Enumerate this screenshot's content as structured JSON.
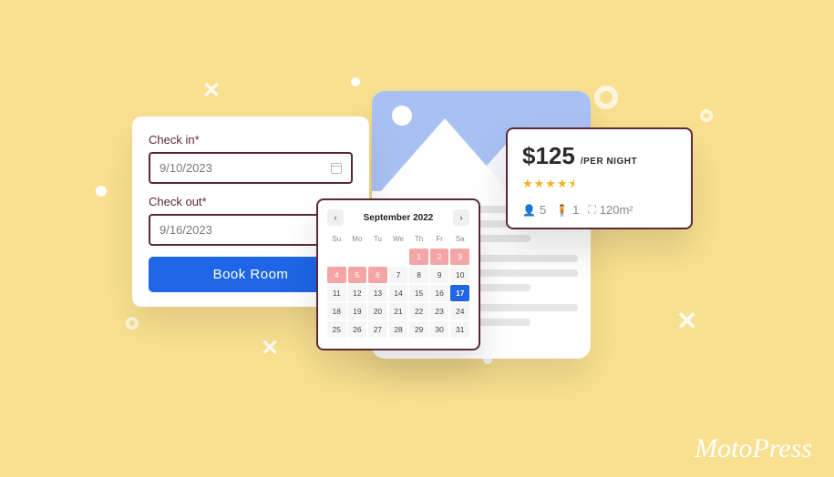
{
  "brand": "MotoPress",
  "booking": {
    "checkin_label": "Check in*",
    "checkin_value": "9/10/2023",
    "checkout_label": "Check out*",
    "checkout_value": "9/16/2023",
    "button": "Book Room"
  },
  "calendar": {
    "title": "September 2022",
    "dow": [
      "Su",
      "Mo",
      "Tu",
      "We",
      "Th",
      "Fr",
      "Sa"
    ],
    "blanks": 4,
    "days": 31,
    "past_end": 6,
    "selected": 17
  },
  "price": {
    "amount": "$125",
    "unit": "/PER NIGHT",
    "rating": 4.5,
    "guests": "5",
    "beds": "1",
    "area": "120m²"
  }
}
